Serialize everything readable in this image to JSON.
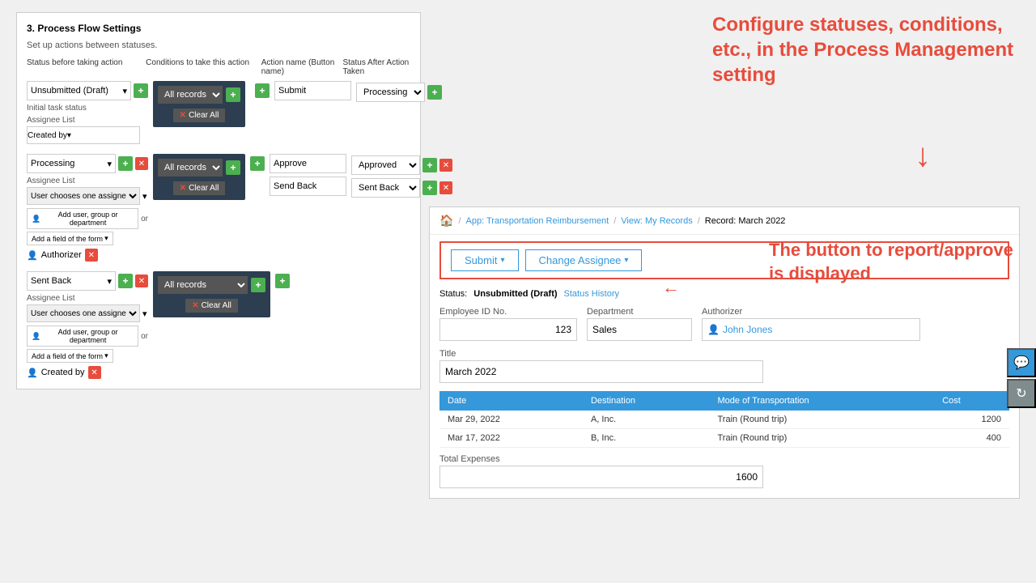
{
  "left_panel": {
    "title": "3. Process Flow Settings",
    "subtitle": "Set up actions between statuses.",
    "col_headers": {
      "status": "Status before taking action",
      "conditions": "Conditions to take this action",
      "action_name": "Action name (Button name)",
      "status_after": "Status After Action Taken"
    },
    "rows": [
      {
        "id": "row1",
        "status": "Unsubmitted (Draft)",
        "initial_task_label": "Initial task status",
        "assignee_label": "Assignee List",
        "assignee": "Created by",
        "condition": "All records",
        "action": "Submit",
        "status_after": "Processing"
      },
      {
        "id": "row2",
        "status": "Processing",
        "assignee_label": "Assignee List",
        "assignee": "User chooses one assignee from the list to take action",
        "condition": "All records",
        "actions": [
          {
            "name": "Approve",
            "after": "Approved"
          },
          {
            "name": "Send Back",
            "after": "Sent Back"
          }
        ],
        "add_user_label": "Add user, group or department",
        "or_text": "or",
        "add_field_label": "Add a field of the form",
        "authorizer_label": "Authorizer"
      },
      {
        "id": "row3",
        "status": "Sent Back",
        "assignee_label": "Assignee List",
        "assignee": "User chooses one assignee from the list to take action",
        "condition": "All records",
        "add_user_label": "Add user, group or department",
        "or_text": "or",
        "add_field_label": "Add a field of the form",
        "created_by_label": "Created by"
      }
    ],
    "clear_all": "Clear All"
  },
  "annotation1": {
    "text": "Configure statuses, conditions, etc., in the Process Management setting"
  },
  "right_panel": {
    "breadcrumb": {
      "home_icon": "🏠",
      "app_label": "App: Transportation Reimbursement",
      "view_label": "View: My Records",
      "record_label": "Record: March 2022"
    },
    "action_buttons": {
      "submit_label": "Submit",
      "change_assignee_label": "Change Assignee"
    },
    "status": {
      "label": "Status:",
      "value": "Unsubmitted (Draft)",
      "history_link": "Status History"
    },
    "employee_id": {
      "label": "Employee ID No.",
      "value": "123"
    },
    "department": {
      "label": "Department",
      "value": "Sales"
    },
    "authorizer": {
      "label": "Authorizer",
      "value": "John Jones"
    },
    "title": {
      "label": "Title",
      "value": "March 2022"
    },
    "table": {
      "headers": [
        "Date",
        "Destination",
        "Mode of Transportation",
        "Cost"
      ],
      "rows": [
        {
          "date": "Mar 29, 2022",
          "destination": "A, Inc.",
          "mode": "Train (Round trip)",
          "cost": "1200"
        },
        {
          "date": "Mar 17, 2022",
          "destination": "B, Inc.",
          "mode": "Train (Round trip)",
          "cost": "400"
        }
      ]
    },
    "total_label": "Total Expenses",
    "total_value": "1600"
  },
  "annotation2": {
    "text": "The button to report/approve is displayed"
  }
}
